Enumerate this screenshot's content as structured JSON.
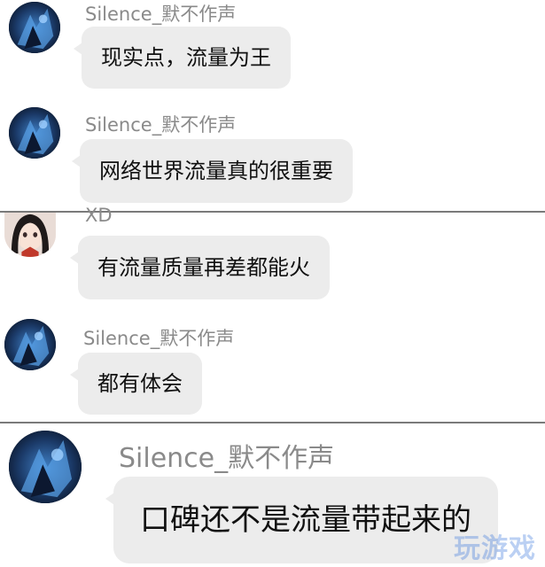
{
  "messages": [
    {
      "sender": "Silence_默不作声",
      "avatar": "anime-blue-avatar",
      "text": "现实点，流量为王"
    },
    {
      "sender": "Silence_默不作声",
      "avatar": "anime-blue-avatar",
      "text": "网络世界流量真的很重要"
    },
    {
      "sender": "XD",
      "avatar": "anime-girl-avatar",
      "text": "有流量质量再差都能火"
    },
    {
      "sender": "Silence_默不作声",
      "avatar": "anime-blue-avatar",
      "text": "都有体会"
    },
    {
      "sender": "Silence_默不作声",
      "avatar": "anime-blue-avatar",
      "text": "口碑还不是流量带起来的"
    }
  ],
  "watermark": {
    "text": "玩游戏"
  },
  "colors": {
    "bubble": "#ececec",
    "name": "#8a8a8a",
    "divider": "#7a7a7a"
  }
}
